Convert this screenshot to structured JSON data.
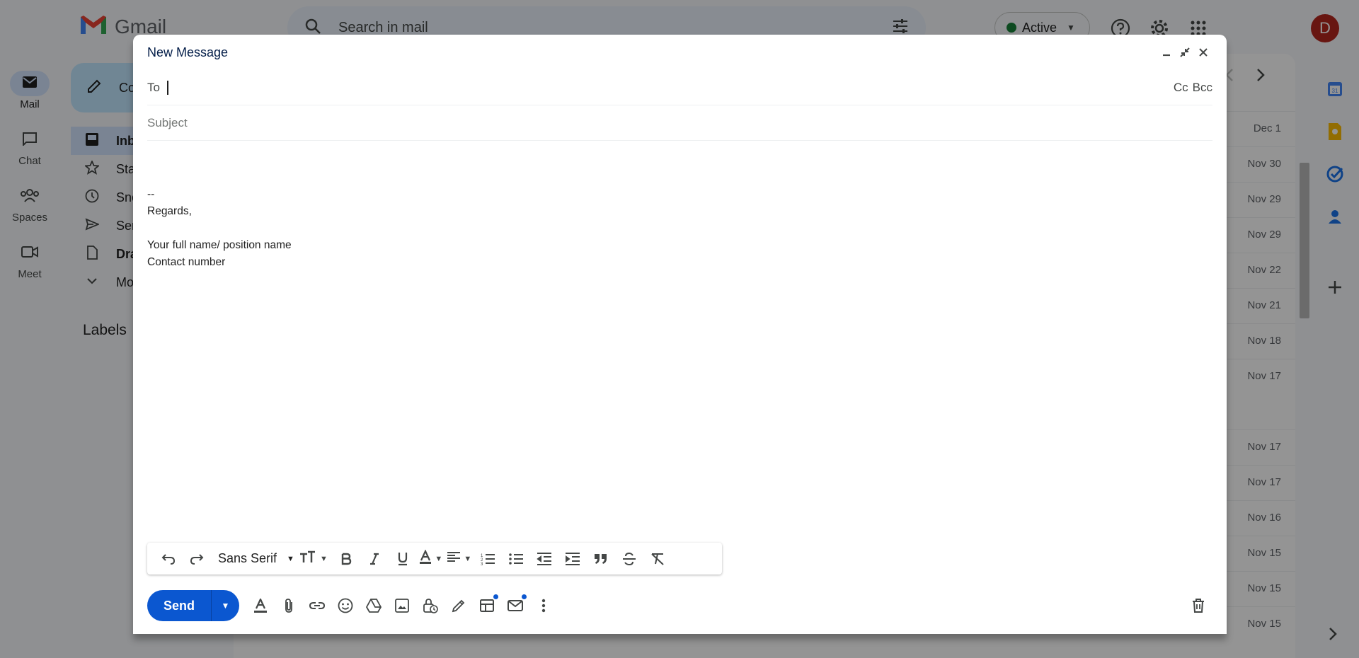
{
  "app": {
    "name": "Gmail"
  },
  "rail": [
    {
      "label": "Mail",
      "icon": "mail-icon",
      "active": true
    },
    {
      "label": "Chat",
      "icon": "chat-icon"
    },
    {
      "label": "Spaces",
      "icon": "spaces-icon"
    },
    {
      "label": "Meet",
      "icon": "meet-icon"
    }
  ],
  "search": {
    "placeholder": "Search in mail"
  },
  "status": {
    "label": "Active",
    "color": "#188038"
  },
  "avatar": {
    "initial": "D",
    "color": "#b3261e"
  },
  "sidebar": {
    "compose_label": "Co",
    "items": [
      {
        "label": "Inb",
        "icon": "inbox-icon"
      },
      {
        "label": "Sta",
        "icon": "star-icon"
      },
      {
        "label": "Sno",
        "icon": "clock-icon"
      },
      {
        "label": "Sen",
        "icon": "send-icon"
      },
      {
        "label": "Dra",
        "icon": "draft-icon"
      },
      {
        "label": "Mo",
        "icon": "chevron-down-icon"
      }
    ],
    "labels_heading": "Labels"
  },
  "inbox": {
    "dates": [
      "Dec 1",
      "Nov 30",
      "Nov 29",
      "Nov 29",
      "Nov 22",
      "Nov 21",
      "Nov 18",
      "Nov 17",
      "Nov 17",
      "Nov 17",
      "Nov 16",
      "Nov 15",
      "Nov 15",
      "Nov 15"
    ]
  },
  "compose": {
    "title": "New Message",
    "to_label": "To",
    "cc_label": "Cc",
    "bcc_label": "Bcc",
    "subject_placeholder": "Subject",
    "signature": {
      "separator": "--",
      "regards": "Regards,",
      "name_line": "Your full name/ position name",
      "contact_line": "Contact number"
    },
    "font_name": "Sans Serif",
    "send_label": "Send",
    "accent": "#0b57d0"
  }
}
